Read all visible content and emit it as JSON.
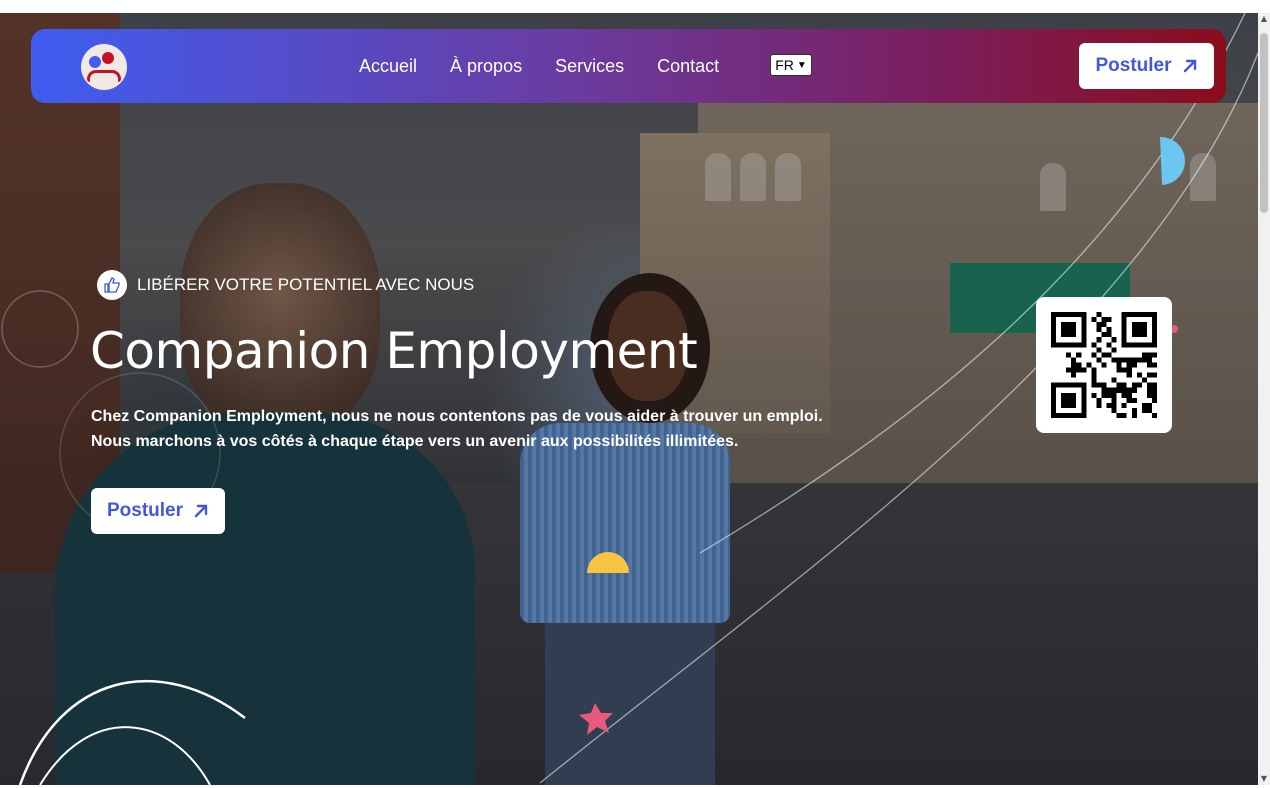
{
  "nav": {
    "links": [
      "Accueil",
      "À propos",
      "Services",
      "Contact"
    ],
    "language": "FR",
    "apply_label": "Postuler"
  },
  "hero": {
    "tagline": "LIBÉRER VOTRE POTENTIEL AVEC NOUS",
    "title": "Companion Employment",
    "text_line1": "Chez Companion Employment, nous ne nous contentons pas de vous aider à trouver un emploi.",
    "text_line2": "Nous marchons à vos côtés à chaque étape vers un avenir aux possibilités illimitées.",
    "apply_label": "Postuler"
  },
  "colors": {
    "nav_gradient_start": "#3f5df0",
    "nav_gradient_end": "#8a0d1c",
    "accent_blue": "#4457d9",
    "deco_yellow": "#f5c543",
    "deco_blue": "#6cc6f0",
    "deco_pink": "#e95a7a"
  },
  "icons": {
    "logo": "people-logo-icon",
    "tagline": "thumbs-up-icon",
    "arrow": "arrow-up-right-icon",
    "qr": "qr-code-icon"
  }
}
